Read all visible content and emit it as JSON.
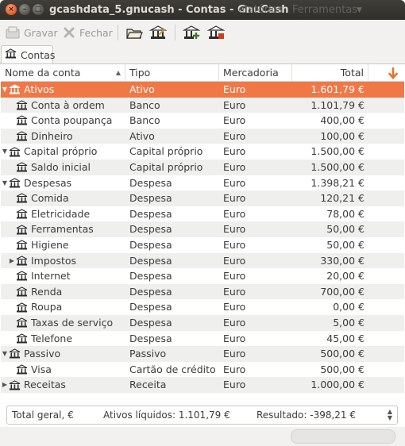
{
  "window": {
    "title": "gcashdata_5.gnucash - Contas - GnuCash",
    "ghost_menu": [
      "elatórios",
      "Ferramentas"
    ]
  },
  "toolbar": {
    "save_label": "Gravar",
    "close_label": "Fechar"
  },
  "tab": {
    "label": "Contas"
  },
  "columns": {
    "name": "Nome da conta",
    "type": "Tipo",
    "commodity": "Mercadoria",
    "total": "Total"
  },
  "rows": [
    {
      "name": "Ativos",
      "type": "Ativo",
      "commodity": "Euro",
      "total": "1.601,79 €",
      "level": 0,
      "expander": "open",
      "selected": true
    },
    {
      "name": "Conta à ordem",
      "type": "Banco",
      "commodity": "Euro",
      "total": "1.101,79 €",
      "level": 1,
      "expander": ""
    },
    {
      "name": "Conta poupança",
      "type": "Banco",
      "commodity": "Euro",
      "total": "400,00 €",
      "level": 1,
      "expander": ""
    },
    {
      "name": "Dinheiro",
      "type": "Ativo",
      "commodity": "Euro",
      "total": "100,00 €",
      "level": 1,
      "expander": ""
    },
    {
      "name": "Capital próprio",
      "type": "Capital próprio",
      "commodity": "Euro",
      "total": "1.500,00 €",
      "level": 0,
      "expander": "open"
    },
    {
      "name": "Saldo inicial",
      "type": "Capital próprio",
      "commodity": "Euro",
      "total": "1.500,00 €",
      "level": 1,
      "expander": ""
    },
    {
      "name": "Despesas",
      "type": "Despesa",
      "commodity": "Euro",
      "total": "1.398,21 €",
      "level": 0,
      "expander": "open"
    },
    {
      "name": "Comida",
      "type": "Despesa",
      "commodity": "Euro",
      "total": "120,21 €",
      "level": 1,
      "expander": ""
    },
    {
      "name": "Eletricidade",
      "type": "Despesa",
      "commodity": "Euro",
      "total": "78,00 €",
      "level": 1,
      "expander": ""
    },
    {
      "name": "Ferramentas",
      "type": "Despesa",
      "commodity": "Euro",
      "total": "50,00 €",
      "level": 1,
      "expander": ""
    },
    {
      "name": "Higiene",
      "type": "Despesa",
      "commodity": "Euro",
      "total": "50,00 €",
      "level": 1,
      "expander": ""
    },
    {
      "name": "Impostos",
      "type": "Despesa",
      "commodity": "Euro",
      "total": "330,00 €",
      "level": 1,
      "expander": "closed"
    },
    {
      "name": "Internet",
      "type": "Despesa",
      "commodity": "Euro",
      "total": "20,00 €",
      "level": 1,
      "expander": ""
    },
    {
      "name": "Renda",
      "type": "Despesa",
      "commodity": "Euro",
      "total": "700,00 €",
      "level": 1,
      "expander": ""
    },
    {
      "name": "Roupa",
      "type": "Despesa",
      "commodity": "Euro",
      "total": "0,00 €",
      "level": 1,
      "expander": ""
    },
    {
      "name": "Taxas de serviço",
      "type": "Despesa",
      "commodity": "Euro",
      "total": "5,00 €",
      "level": 1,
      "expander": ""
    },
    {
      "name": "Telefone",
      "type": "Despesa",
      "commodity": "Euro",
      "total": "45,00 €",
      "level": 1,
      "expander": ""
    },
    {
      "name": "Passivo",
      "type": "Passivo",
      "commodity": "Euro",
      "total": "500,00 €",
      "level": 0,
      "expander": "open"
    },
    {
      "name": "Visa",
      "type": "Cartão de crédito",
      "commodity": "Euro",
      "total": "500,00 €",
      "level": 1,
      "expander": ""
    },
    {
      "name": "Receitas",
      "type": "Receita",
      "commodity": "Euro",
      "total": "1.000,00 €",
      "level": 0,
      "expander": "closed"
    }
  ],
  "summary": {
    "total_label": "Total geral, €",
    "net_assets": "Ativos líquidos: 1.101,79 €",
    "result": "Resultado: -398,21 €"
  },
  "colors": {
    "selection": "#f07746",
    "accent_arrow": "#e8722a"
  },
  "icons": {
    "account": "bank-icon",
    "sort_arrow": "triangle-up",
    "column_selector": "arrow-down-icon"
  }
}
